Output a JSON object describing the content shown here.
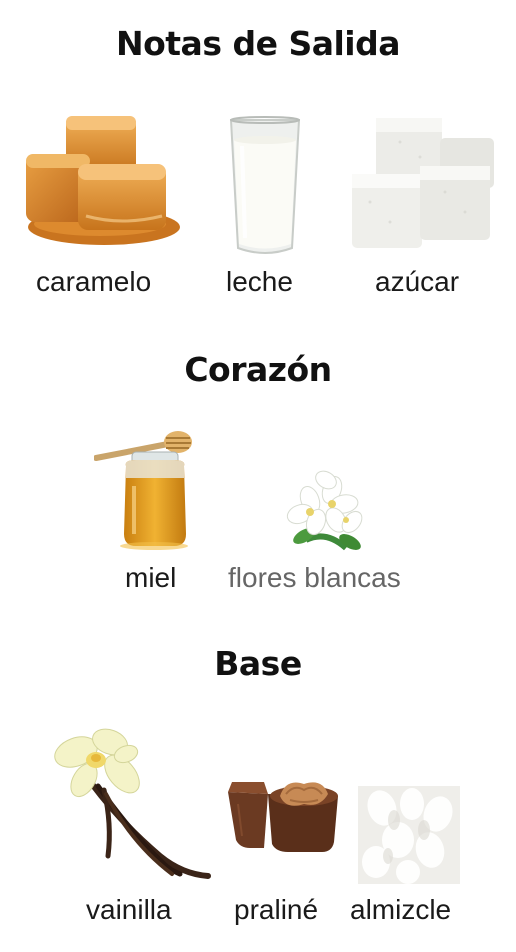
{
  "sections": [
    {
      "title": "Notas de Salida",
      "notes": [
        {
          "label": "caramelo",
          "icon": "caramel-icon"
        },
        {
          "label": "leche",
          "icon": "milk-glass-icon"
        },
        {
          "label": "azúcar",
          "icon": "sugar-cubes-icon"
        }
      ]
    },
    {
      "title": "Corazón",
      "notes": [
        {
          "label": "miel",
          "icon": "honey-jar-icon"
        },
        {
          "label": "flores blancas",
          "icon": "white-flowers-icon"
        }
      ]
    },
    {
      "title": "Base",
      "notes": [
        {
          "label": "vainilla",
          "icon": "vanilla-icon"
        },
        {
          "label": "praliné",
          "icon": "praline-icon"
        },
        {
          "label": "almizcle",
          "icon": "musk-icon"
        }
      ]
    }
  ],
  "colors": {
    "caramel": "#d98a2c",
    "honey": "#e2a020",
    "leaf": "#3e8a3a",
    "chocolate": "#6b3a22",
    "muted_label": "#666666"
  }
}
